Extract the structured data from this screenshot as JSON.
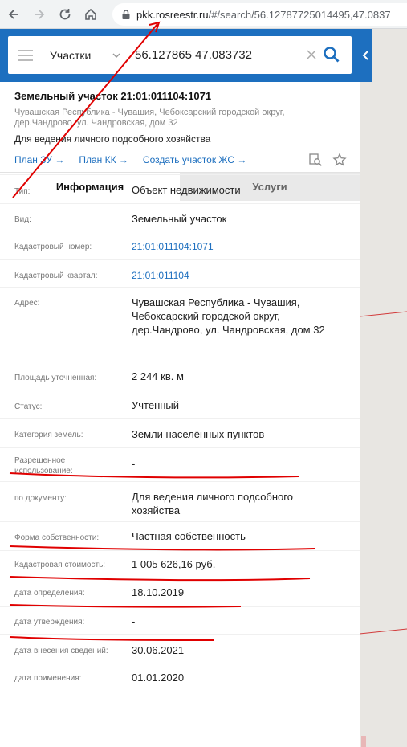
{
  "browser": {
    "url_domain": "pkk.rosreestr.ru",
    "url_path": "/#/search/56.12787725014495,47.0837"
  },
  "search": {
    "layer_label": "Участки",
    "query": "56.127865 47.083732"
  },
  "parcel": {
    "title": "Земельный участок 21:01:011104:1071",
    "address": "Чувашская Республика - Чувашия, Чебоксарский городской округ, дер.Чандрово, ул. Чандровская, дом 32",
    "purpose": "Для ведения личного подсобного хозяйства"
  },
  "links": [
    {
      "label": "План ЗУ →"
    },
    {
      "label": "План КК →"
    },
    {
      "label": "Создать участок ЖС →"
    }
  ],
  "tabs": [
    {
      "label": "Информация",
      "active": true
    },
    {
      "label": "Услуги",
      "active": false
    }
  ],
  "rows": [
    {
      "label": "Тип:",
      "value": "Объект недвижимости"
    },
    {
      "label": "Вид:",
      "value": "Земельный участок"
    },
    {
      "label": "Кадастровый номер:",
      "value": "21:01:011104:1071"
    },
    {
      "label": "Кадастровый квартал:",
      "value": "21:01:011104"
    },
    {
      "label": "Адрес:",
      "value": "Чувашская Республика - Чувашия, Чебоксарский городской округ, дер.Чандрово, ул. Чандровская, дом 32"
    },
    {
      "label": "Площадь уточненная:",
      "value": "2 244 кв. м"
    },
    {
      "label": "Статус:",
      "value": "Учтенный"
    },
    {
      "label": "Категория земель:",
      "value": "Земли населённых пунктов"
    },
    {
      "label": "Разрешенное использование:",
      "value": "-"
    },
    {
      "label": "по документу:",
      "value": "Для ведения личного подсобного хозяйства"
    },
    {
      "label": "Форма собственности:",
      "value": "Частная собственность"
    },
    {
      "label": "Кадастровая стоимость:",
      "value": "1 005 626,16 руб."
    },
    {
      "label": "дата определения:",
      "value": "18.10.2019"
    },
    {
      "label": "дата утверждения:",
      "value": "-"
    },
    {
      "label": "дата внесения сведений:",
      "value": "30.06.2021"
    },
    {
      "label": "дата применения:",
      "value": "01.01.2020"
    }
  ],
  "colors": {
    "accent": "#1d6fbf",
    "annotation": "#e00000"
  }
}
